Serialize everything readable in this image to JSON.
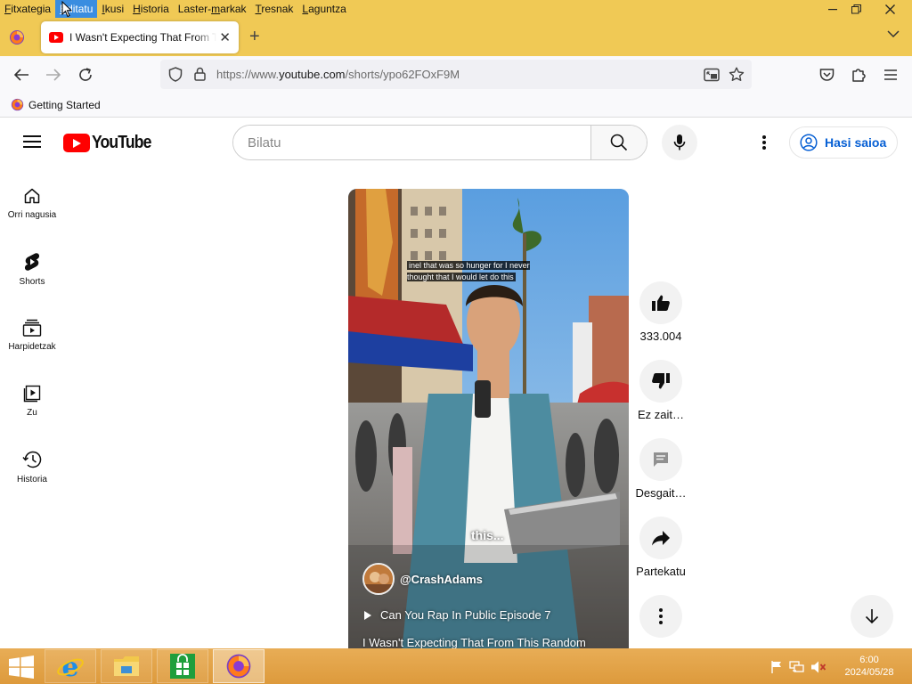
{
  "menubar": {
    "items": [
      {
        "pre": "",
        "ul": "F",
        "post": "itxategia"
      },
      {
        "pre": "",
        "ul": "E",
        "post": "ditatu"
      },
      {
        "pre": "",
        "ul": "I",
        "post": "kusi"
      },
      {
        "pre": "",
        "ul": "H",
        "post": "istoria"
      },
      {
        "pre": "Laster-",
        "ul": "m",
        "post": "arkak"
      },
      {
        "pre": "",
        "ul": "T",
        "post": "resnak"
      },
      {
        "pre": "",
        "ul": "L",
        "post": "aguntza"
      }
    ],
    "highlighted_index": 1
  },
  "tab": {
    "title": "I Wasn't Expecting That From This Random",
    "favicon": "youtube-icon"
  },
  "address_bar": {
    "url_prefix": "https://www.",
    "url_domain": "youtube.com",
    "url_path": "/shorts/ypo62FOxF9M"
  },
  "bookmarks": {
    "items": [
      {
        "label": "Getting Started",
        "icon": "firefox-icon"
      }
    ]
  },
  "youtube": {
    "logo_text": "YouTube",
    "search_placeholder": "Bilatu",
    "signin_label": "Hasi saioa",
    "sidebar": [
      {
        "label": "Orri nagusia",
        "icon": "home-icon"
      },
      {
        "label": "Shorts",
        "icon": "shorts-icon"
      },
      {
        "label": "Harpidetzak",
        "icon": "subscriptions-icon"
      },
      {
        "label": "Zu",
        "icon": "you-icon"
      },
      {
        "label": "Historia",
        "icon": "history-icon"
      }
    ],
    "short": {
      "caption_top": "inel that was so hunger for I never thought that I would let do this",
      "caption_bottom": "this...",
      "channel": "@CrashAdams",
      "playlist": "Can You Rap In Public Episode 7",
      "title": "I Wasn't Expecting That From This Random"
    },
    "actions": {
      "like_count": "333.004",
      "dislike_label": "Ez zait…",
      "comments_label": "Desgait…",
      "share_label": "Partekatu"
    }
  },
  "taskbar": {
    "time": "6:00",
    "date": "2024/05/28",
    "apps": [
      "internet-explorer-icon",
      "file-explorer-icon",
      "store-icon",
      "firefox-icon"
    ]
  },
  "colors": {
    "firefox_chrome": "#f0c955",
    "youtube_red": "#ff0000",
    "link_blue": "#065fd4",
    "taskbar": "#dd9a3c"
  }
}
